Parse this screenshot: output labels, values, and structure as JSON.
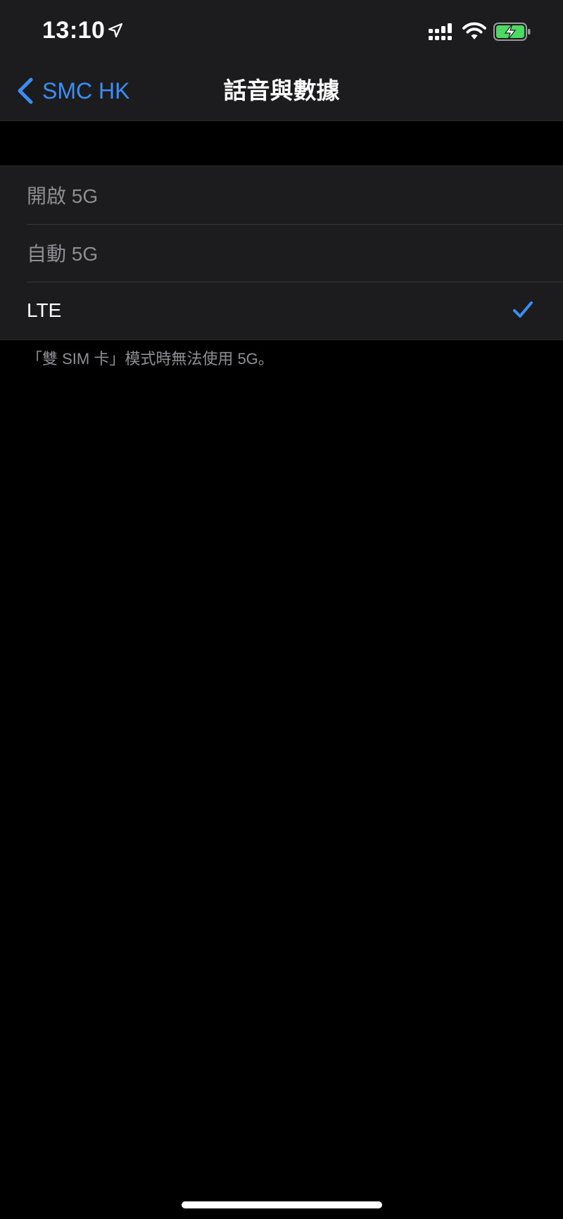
{
  "status_bar": {
    "time": "13:10",
    "location_icon": "location-arrow-icon",
    "signal_icon": "cellular-dual-sim-icon",
    "wifi_icon": "wifi-icon",
    "battery_icon": "battery-charging-icon",
    "battery_color": "#4cd964"
  },
  "nav": {
    "back_label": "SMC HK",
    "title": "話音與數據"
  },
  "options": [
    {
      "label": "開啟 5G",
      "enabled": false,
      "selected": false
    },
    {
      "label": "自動 5G",
      "enabled": false,
      "selected": false
    },
    {
      "label": "LTE",
      "enabled": true,
      "selected": true
    }
  ],
  "footer": {
    "note": "「雙 SIM 卡」模式時無法使用 5G。"
  },
  "colors": {
    "accent": "#3a8ef6",
    "background": "#000000",
    "grouped_background": "#1c1c1e",
    "secondary_text": "#8e8e93"
  }
}
